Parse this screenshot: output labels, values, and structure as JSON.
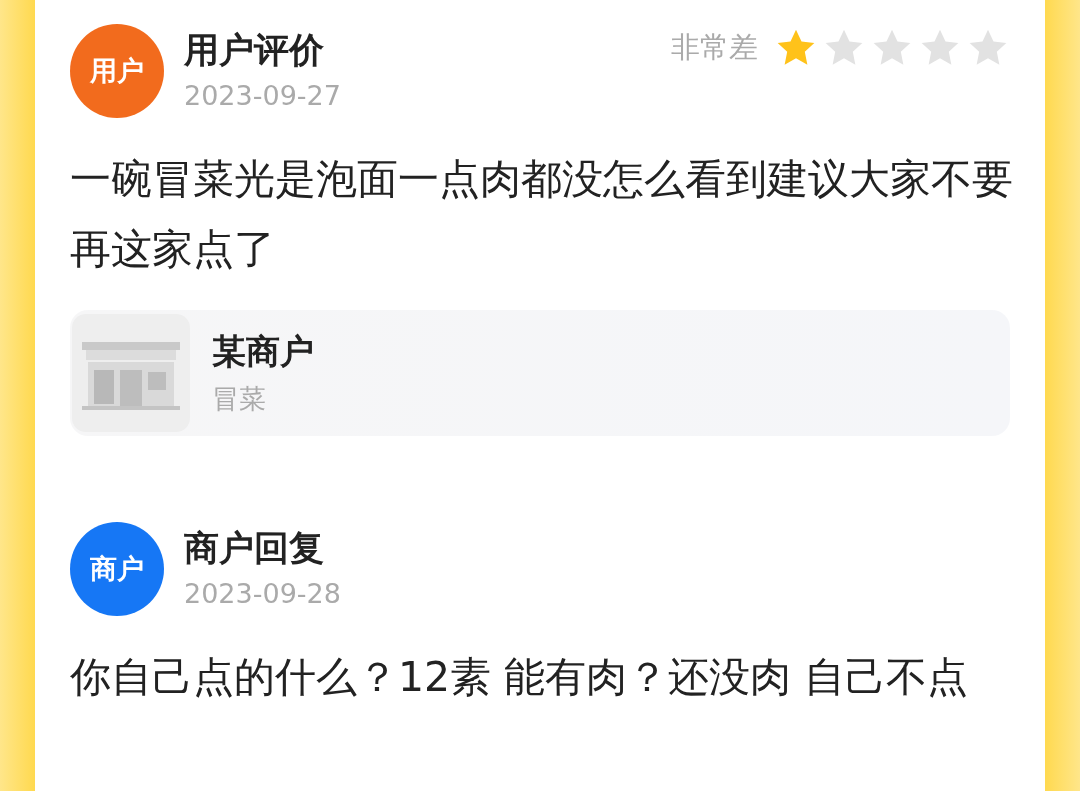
{
  "review": {
    "avatar": "用户",
    "title": "用户评价",
    "date": "2023-09-27",
    "rating_label": "非常差",
    "stars": 1,
    "text": "一碗冒菜光是泡面一点肉都没怎么看到建议大家不要再这家点了"
  },
  "merchant_card": {
    "name": "某商户",
    "category": "冒菜"
  },
  "reply": {
    "avatar": "商户",
    "title": "商户回复",
    "date": "2023-09-28",
    "text": "你自己点的什么？12素 能有肉？还没肉 自己不点"
  }
}
